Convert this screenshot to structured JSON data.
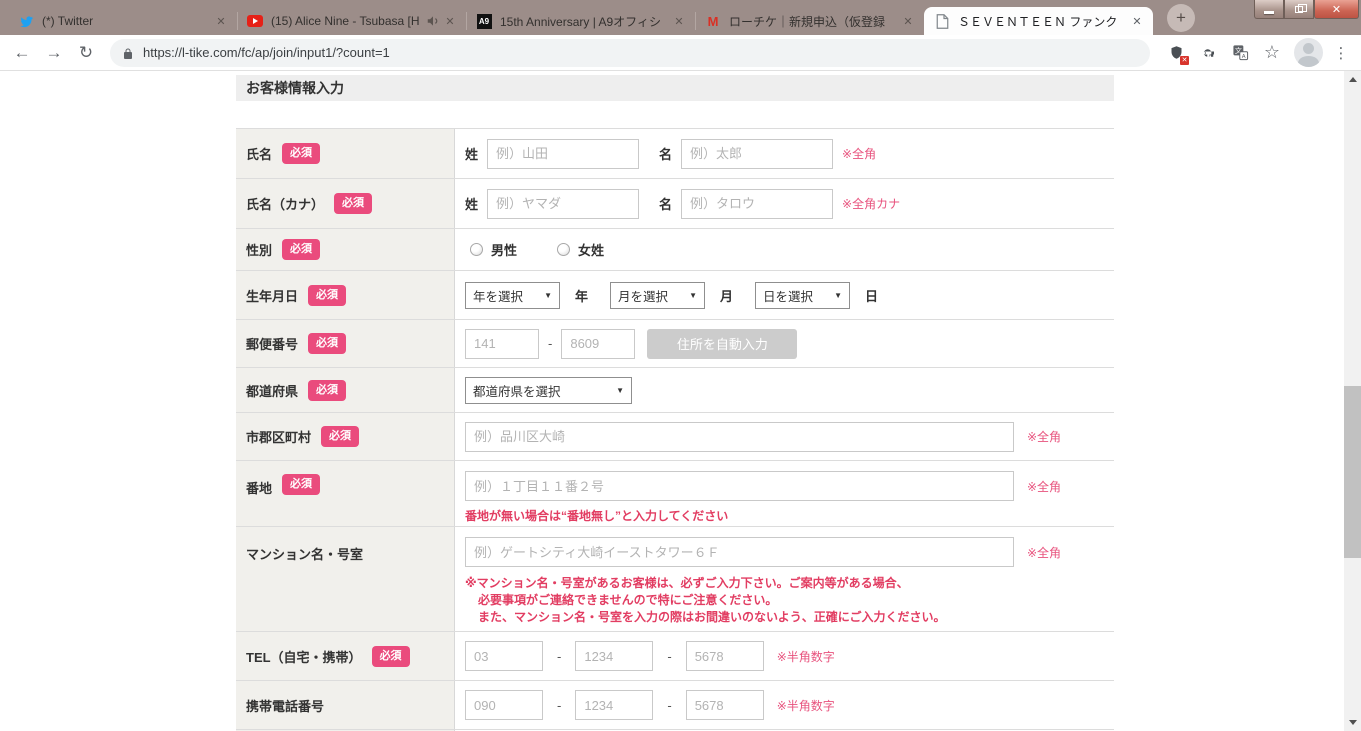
{
  "colors": {
    "accent_pink": "#ea4b7d",
    "note_pink": "#e8537e",
    "button_gray": "#cccccc"
  },
  "icons": {
    "close": "✕",
    "plus": "+",
    "back": "←",
    "forward": "→",
    "reload": "↻",
    "star": "☆",
    "dots": "⋮",
    "caret": "▼",
    "badge_x": "✕",
    "a9_logo": "A9",
    "gmail_m": "M"
  },
  "browser": {
    "tabs": [
      {
        "title": "(*) Twitter"
      },
      {
        "title": "(15) Alice Nine - Tsubasa [H"
      },
      {
        "title": "15th Anniversary | A9オフィシ"
      },
      {
        "title": "ローチケ｜新規申込（仮登録"
      },
      {
        "title": "ＳＥＶＥＮＴＥＥＮ ファンク"
      }
    ],
    "url": "https://l-tike.com/fc/ap/join/input1/?count=1"
  },
  "page": {
    "header": "お客様情報入力",
    "required_label": "必須",
    "sep": "-",
    "rows": {
      "name": {
        "label": "氏名",
        "sei": "姓",
        "mei": "名",
        "sei_ph": "例）山田",
        "mei_ph": "例）太郎",
        "note": "※全角"
      },
      "kana": {
        "label": "氏名（カナ）",
        "sei": "姓",
        "mei": "名",
        "sei_ph": "例）ヤマダ",
        "mei_ph": "例）タロウ",
        "note": "※全角カナ"
      },
      "gender": {
        "label": "性別",
        "options": [
          "男性",
          "女姓"
        ]
      },
      "birth": {
        "label": "生年月日",
        "year": "年を選択",
        "year_suffix": "年",
        "month": "月を選択",
        "month_suffix": "月",
        "day": "日を選択",
        "day_suffix": "日"
      },
      "zip": {
        "label": "郵便番号",
        "part1": "141",
        "part2": "8609",
        "button": "住所を自動入力"
      },
      "pref": {
        "label": "都道府県",
        "value": "都道府県を選択"
      },
      "city": {
        "label": "市郡区町村",
        "ph": "例）品川区大崎",
        "note": "※全角"
      },
      "banchi": {
        "label": "番地",
        "ph": "例）１丁目１１番２号",
        "note": "※全角",
        "warning": "番地が無い場合は“番地無し”と入力してください"
      },
      "mansion": {
        "label": "マンション名・号室",
        "ph": "例）ゲートシティ大崎イーストタワー６Ｆ",
        "note": "※全角",
        "warning1": "※マンション名・号室があるお客様は、必ずご入力下さい。ご案内等がある場合、",
        "warning2": "必要事項がご連絡できませんので特にご注意ください。",
        "warning3": "また、マンション名・号室を入力の際はお間違いのないよう、正確にご入力ください。"
      },
      "tel": {
        "label": "TEL（自宅・携帯）",
        "p1": "03",
        "p2": "1234",
        "p3": "5678",
        "note": "※半角数字"
      },
      "mobile": {
        "label": "携帯電話番号",
        "p1": "090",
        "p2": "1234",
        "p3": "5678",
        "note": "※半角数字"
      }
    }
  }
}
